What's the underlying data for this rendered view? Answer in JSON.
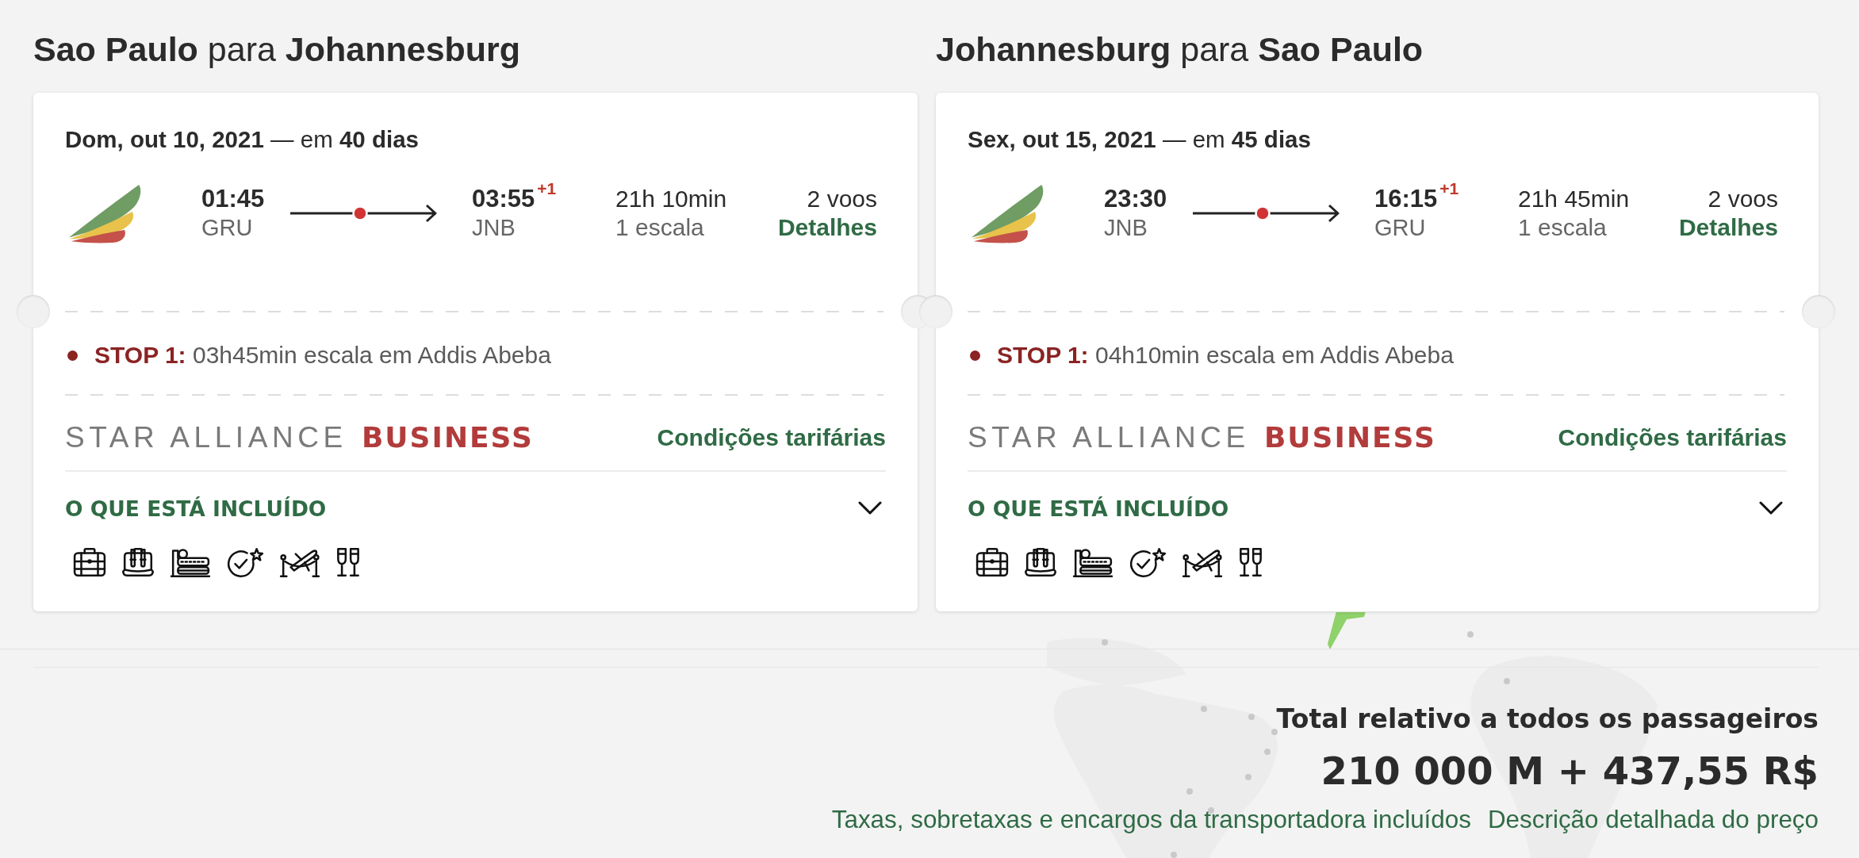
{
  "trips": [
    {
      "title": "**Sao Paulo** para **Johannesburg**",
      "date_line": "**Dom, out 10, 2021** — em **40 dias**",
      "departure": {
        "time": "01:45",
        "airport": "GRU"
      },
      "arrival": {
        "time": "03:55",
        "day_offset": "+1",
        "airport": "JNB"
      },
      "duration": "21h 10min",
      "stops_summary": "1 escala",
      "flights": "2 voos",
      "details_link": "Detalhes",
      "stops": [
        {
          "text": "**STOP 1:** 03h45min escala em Addis Abeba"
        }
      ],
      "fare": {
        "alliance": "STAR ALLIANCE",
        "cabin": "BUSINESS"
      },
      "fare_conditions_link": "Condições tarifárias",
      "included": {
        "label": "O QUE ESTÁ INCLUÍDO",
        "expanded": false
      }
    },
    {
      "title": "**Johannesburg** para **Sao Paulo**",
      "date_line": "**Sex, out 15, 2021** — em **45 dias**",
      "departure": {
        "time": "23:30",
        "airport": "JNB"
      },
      "arrival": {
        "time": "16:15",
        "day_offset": "+1",
        "airport": "GRU"
      },
      "duration": "21h 45min",
      "stops_summary": "1 escala",
      "flights": "2 voos",
      "details_link": "Detalhes",
      "stops": [
        {
          "text": "**STOP 1:** 04h10min escala em Addis Abeba"
        }
      ],
      "fare": {
        "alliance": "STAR ALLIANCE",
        "cabin": "BUSINESS"
      },
      "fare_conditions_link": "Condições tarifárias",
      "included": {
        "label": "O QUE ESTÁ INCLUÍDO",
        "expanded": false
      }
    }
  ],
  "total": {
    "label": "Total relativo a todos os passageiros",
    "amount": "210 000 M + 437,55 R$"
  },
  "links": [
    "Taxas, sobretaxas e encargos da transportadora incluídos",
    "Descrição detalhada do preço"
  ]
}
